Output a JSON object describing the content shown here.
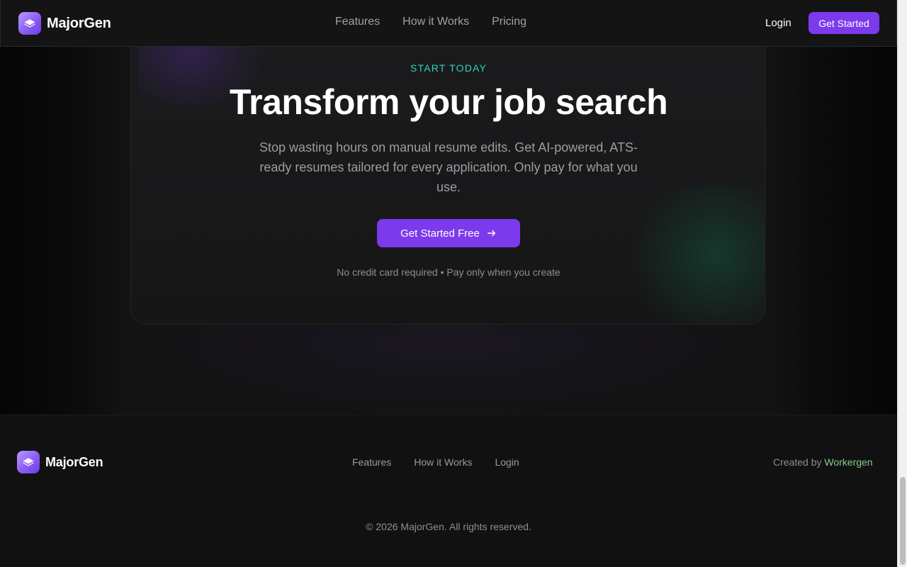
{
  "brand": {
    "name": "MajorGen",
    "logo_icon": "layers-icon"
  },
  "nav": {
    "links": [
      "Features",
      "How it Works",
      "Pricing"
    ],
    "login_label": "Login",
    "cta_label": "Get Started"
  },
  "cta": {
    "eyebrow": "START TODAY",
    "headline": "Transform your job search",
    "subtext": "Stop wasting hours on manual resume edits. Get AI-powered, ATS-ready resumes tailored for every application. Only pay for what you use.",
    "button_label": "Get Started Free",
    "button_icon": "arrow-right-icon",
    "fineprint": "No credit card required • Pay only when you create"
  },
  "footer": {
    "links": [
      "Features",
      "How it Works",
      "Login"
    ],
    "credit_prefix": "Created by",
    "credit_name": "Workergen",
    "copyright": "© 2026 MajorGen. All rights reserved."
  },
  "colors": {
    "accent": "#7c3aed",
    "eyebrow": "#2dd4bf",
    "credit_link": "#86c98a",
    "background": "#0a0a0b"
  }
}
